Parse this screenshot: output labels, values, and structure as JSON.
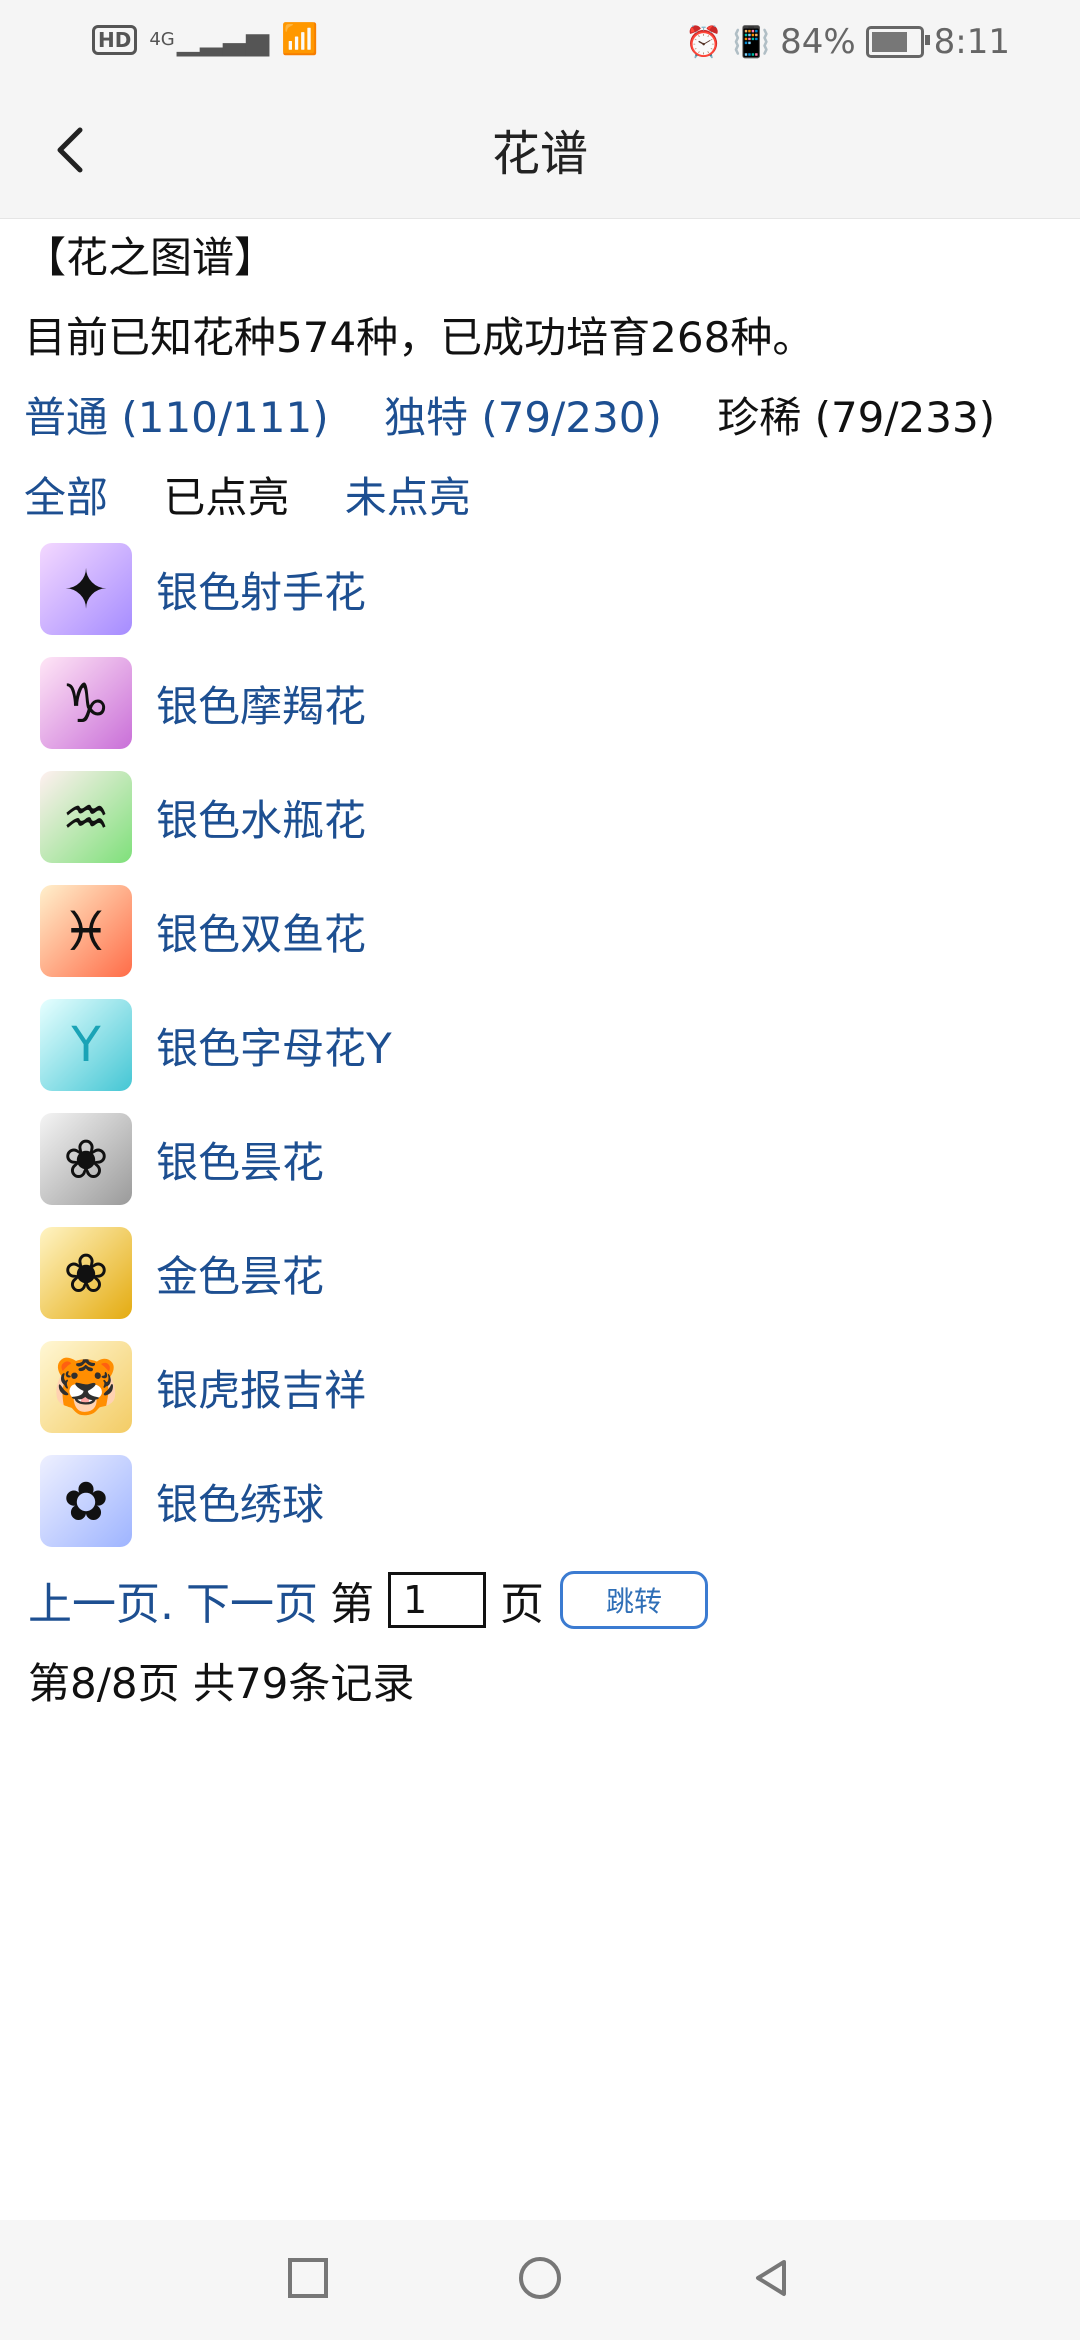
{
  "status": {
    "signal": "4G",
    "battery_percent": "84%",
    "time": "8:11"
  },
  "header": {
    "title": "花谱"
  },
  "content": {
    "section_title": "【花之图谱】",
    "summary_text": "目前已知花种574种，已成功培育268种。",
    "filters": [
      {
        "label": "普通 (110/111)"
      },
      {
        "label": "独特 (79/230)"
      },
      {
        "label": "珍稀 (79/233)"
      }
    ],
    "tabs": [
      {
        "label": "全部"
      },
      {
        "label": "已点亮"
      },
      {
        "label": "未点亮"
      }
    ],
    "items": [
      {
        "label": "银色射手花",
        "icon": "sagittarius-flower-icon"
      },
      {
        "label": "银色摩羯花",
        "icon": "capricorn-flower-icon"
      },
      {
        "label": "银色水瓶花",
        "icon": "aquarius-flower-icon"
      },
      {
        "label": "银色双鱼花",
        "icon": "pisces-flower-icon"
      },
      {
        "label": "银色字母花Y",
        "icon": "letter-y-flower-icon"
      },
      {
        "label": "银色昙花",
        "icon": "silver-epiphyllum-icon"
      },
      {
        "label": "金色昙花",
        "icon": "gold-epiphyllum-icon"
      },
      {
        "label": "银虎报吉祥",
        "icon": "tiger-flower-icon"
      },
      {
        "label": "银色绣球",
        "icon": "hydrangea-icon"
      }
    ]
  },
  "pager": {
    "prev": "上一页.",
    "next": "下一页",
    "prefix": "第",
    "suffix": "页",
    "input_value": "1",
    "jump_label": "跳转",
    "summary": "第8/8页 共79条记录"
  }
}
